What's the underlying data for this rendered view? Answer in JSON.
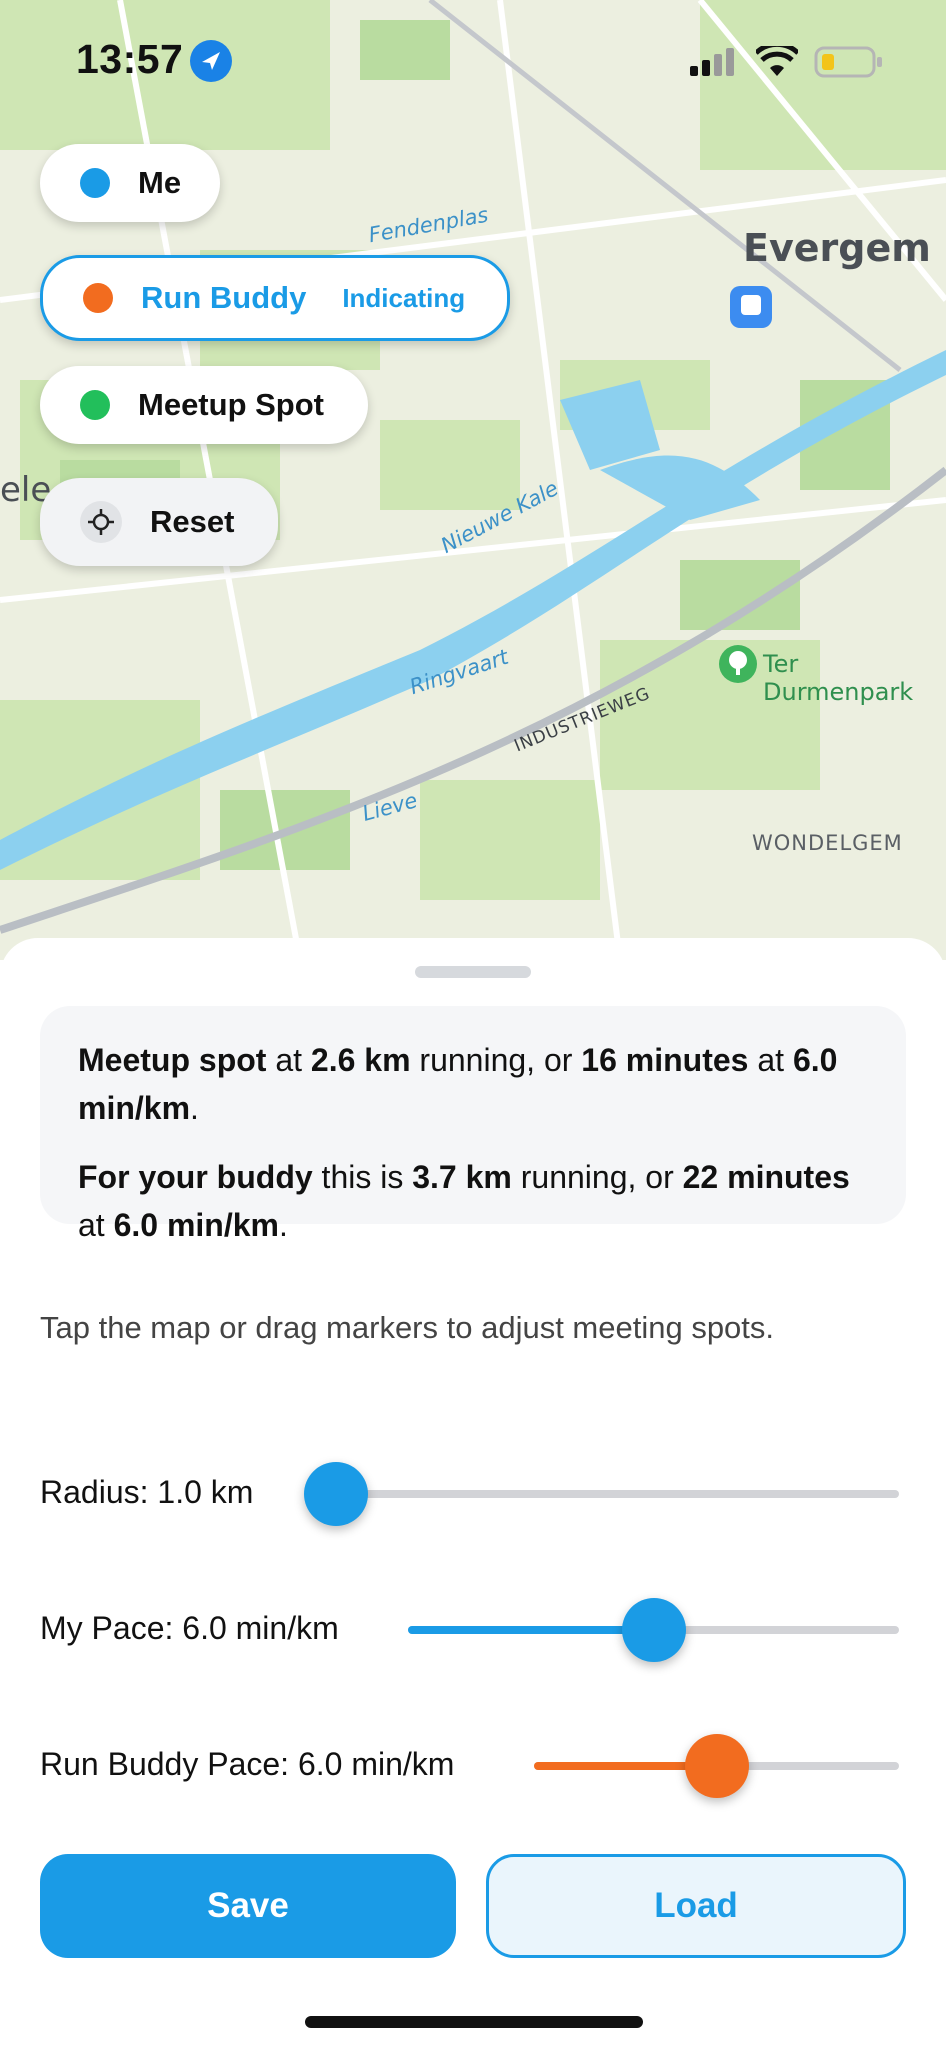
{
  "status_bar": {
    "time": "13:57"
  },
  "colors": {
    "me": "#1a9be6",
    "buddy": "#f26c1f",
    "meetup": "#22bf5b",
    "accent": "#1a9be6"
  },
  "map": {
    "labels": {
      "city": "Evergem",
      "canal": "Nieuwe Kale",
      "ringvaart": "Ringvaart",
      "industrieweg": "INDUSTRIEWEG",
      "lieve": "Lieve",
      "wondelgem": "WONDELGEM",
      "park": "Ter Durmenpark",
      "fendenplas": "Fendenplas",
      "ele": "ele"
    },
    "icons": [
      "train-station-icon",
      "park-tree-icon"
    ]
  },
  "legend": {
    "me": {
      "label": "Me"
    },
    "buddy": {
      "label": "Run Buddy",
      "tag": "Indicating"
    },
    "meetup": {
      "label": "Meetup Spot"
    },
    "reset": {
      "label": "Reset",
      "icon": "crosshair-icon"
    }
  },
  "info": {
    "line1": {
      "a": "Meetup spot",
      "b": " at ",
      "c": "2.6 km",
      "d": " running, or ",
      "e": "16 minutes",
      "f": " at ",
      "g": "6.0 min/km",
      "h": "."
    },
    "line2": {
      "a": "For your buddy",
      "b": " this is ",
      "c": "3.7 km",
      "d": " running, or ",
      "e": "22 minutes",
      "f": " at ",
      "g": "6.0 min/km",
      "h": "."
    }
  },
  "hint": "Tap the map or drag markers to adjust meeting spots.",
  "sliders": {
    "radius": {
      "label": "Radius: 1.0 km",
      "value_fraction": 0.0
    },
    "my_pace": {
      "label": "My Pace: 6.0 min/km",
      "value_fraction": 0.5
    },
    "buddy_pace": {
      "label": "Run Buddy Pace: 6.0 min/km",
      "value_fraction": 0.5
    }
  },
  "buttons": {
    "save": "Save",
    "load": "Load"
  }
}
